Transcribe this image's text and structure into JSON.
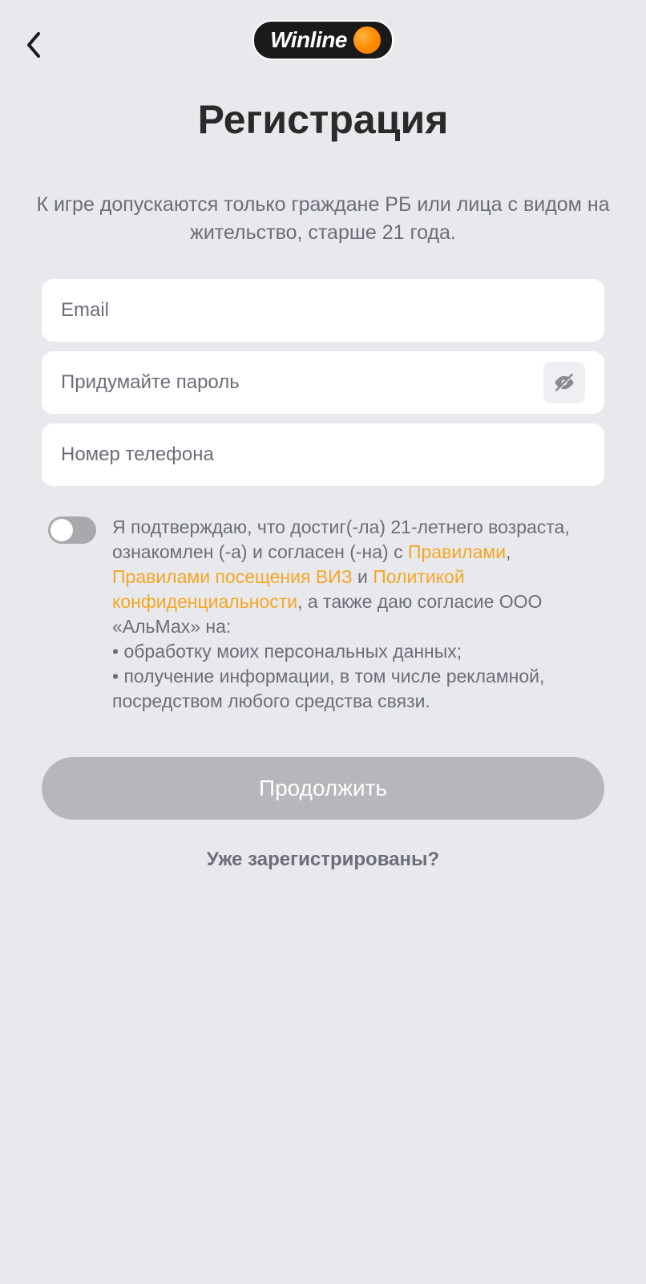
{
  "logo": {
    "text": "Winline"
  },
  "title": "Регистрация",
  "subtitle": "К игре допускаются только граждане РБ или лица с видом на жительство, старше 21 года.",
  "form": {
    "email_placeholder": "Email",
    "password_placeholder": "Придумайте пароль",
    "phone_placeholder": "Номер телефона"
  },
  "consent": {
    "part1": "Я подтверждаю, что достиг(-ла) 21-летнего возраста, ознакомлен (-а) и согласен (-на) с ",
    "link1": "Правилами",
    "sep1": ", ",
    "link2": "Правилами посещения ВИЗ",
    "sep2": " и ",
    "link3": "Политикой конфиденциальности",
    "part2": ",  а также даю согласие ООО «АльМах» на:",
    "bullet1": "  • обработку моих персональных данных;",
    "bullet2": "  • получение информации, в том числе рекламной, посредством любого средства связи."
  },
  "continue_label": "Продолжить",
  "already_label": "Уже зарегистрированы?"
}
